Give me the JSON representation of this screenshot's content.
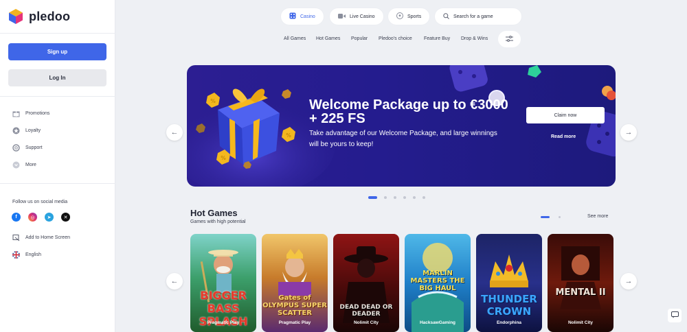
{
  "brand": {
    "name": "pledoo"
  },
  "sidebar": {
    "signup_label": "Sign up",
    "login_label": "Log In",
    "items": [
      {
        "label": "Promotions",
        "icon": "gift-icon"
      },
      {
        "label": "Loyalty",
        "icon": "star-icon"
      },
      {
        "label": "Support",
        "icon": "lifebuoy-icon"
      },
      {
        "label": "More",
        "icon": "chevron-down-icon"
      }
    ],
    "social_title": "Follow us on social media",
    "socials": [
      "facebook",
      "instagram",
      "telegram",
      "x"
    ],
    "add_home_label": "Add to Home Screen",
    "language_label": "English"
  },
  "tabs": [
    {
      "label": "Casino",
      "icon": "casino-icon",
      "active": true
    },
    {
      "label": "Live Casino",
      "icon": "camera-icon",
      "active": false
    },
    {
      "label": "Sports",
      "icon": "ball-icon",
      "active": false
    }
  ],
  "search": {
    "placeholder": "Search for a game"
  },
  "categories": [
    "All Games",
    "Hot Games",
    "Popular",
    "Pledoo's choice",
    "Feature Buy",
    "Drop & Wins"
  ],
  "banner": {
    "title": "Welcome Package up to €3000 + 225 FS",
    "subtitle": "Take advantage of our Welcome Package, and large winnings will be yours to keep!",
    "claim_label": "Claim now",
    "readmore_label": "Read more"
  },
  "hot_games": {
    "title": "Hot Games",
    "subtitle": "Games with high potential",
    "see_more_label": "See more",
    "games": [
      {
        "art": "BIGGER BASS SPLASH",
        "provider": "Pragmatic Play"
      },
      {
        "art": "Gates of OLYMPUS SUPER SCATTER",
        "provider": "Pragmatic Play"
      },
      {
        "art": "DEAD DEAD OR DEADER",
        "provider": "Nolimit City"
      },
      {
        "art": "MARLIN MASTERS THE BIG HAUL",
        "provider": "HacksawGaming"
      },
      {
        "art": "THUNDER CROWN",
        "provider": "Endorphina"
      },
      {
        "art": "MENTAL II",
        "provider": "Nolimit City"
      }
    ]
  },
  "colors": {
    "accent": "#3f66e8",
    "banner": "#2a1e90",
    "coin": "#f3b71f"
  }
}
